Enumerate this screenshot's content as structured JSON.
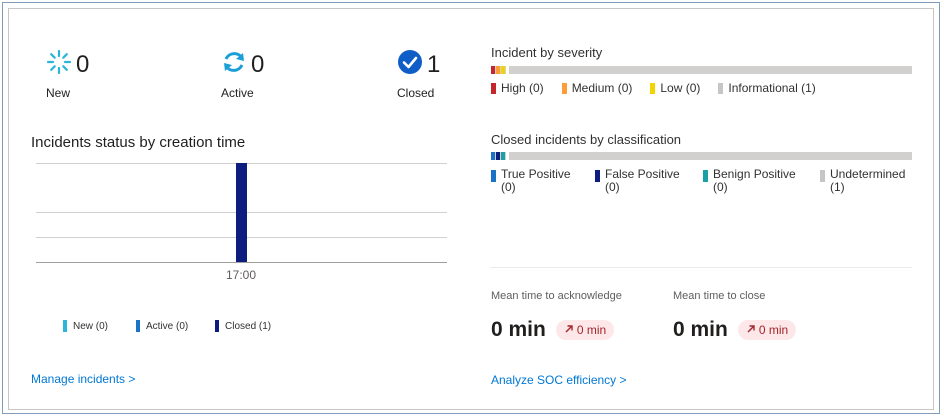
{
  "counters": {
    "new": {
      "value": "0",
      "label": "New",
      "icon": "loading-spinner-icon"
    },
    "active": {
      "value": "0",
      "label": "Active",
      "icon": "refresh-icon"
    },
    "closed": {
      "value": "1",
      "label": "Closed",
      "icon": "check-circle-icon"
    }
  },
  "status_chart": {
    "title": "Incidents status by creation time",
    "footer_link": "Manage incidents >",
    "chart_data": {
      "type": "bar",
      "categories": [
        "17:00"
      ],
      "series": [
        {
          "name": "New (0)",
          "values": [
            0
          ],
          "color": "#2bb6d9"
        },
        {
          "name": "Active (0)",
          "values": [
            0
          ],
          "color": "#1a73c7"
        },
        {
          "name": "Closed (1)",
          "values": [
            1
          ],
          "color": "#0d1d7e"
        }
      ],
      "ylim": [
        0,
        1
      ],
      "grid": true,
      "legend": "bottom"
    }
  },
  "severity": {
    "title": "Incident by severity",
    "items": [
      {
        "label": "High (0)",
        "color": "#c4262c"
      },
      {
        "label": "Medium (0)",
        "color": "#ff9c3a"
      },
      {
        "label": "Low (0)",
        "color": "#f2d400"
      },
      {
        "label": "Informational (1)",
        "color": "#c8c6c4"
      }
    ]
  },
  "classification": {
    "title": "Closed incidents by classification",
    "items": [
      {
        "label_line1": "True Positive",
        "label_line2": "(0)",
        "color": "#1a73c7"
      },
      {
        "label_line1": "False Positive",
        "label_line2": "(0)",
        "color": "#0d1d7e"
      },
      {
        "label_line1": "Benign Positive",
        "label_line2": "(0)",
        "color": "#1aa1a8"
      },
      {
        "label_line1": "Undetermined",
        "label_line2": "(1)",
        "color": "#c8c6c4"
      }
    ]
  },
  "metrics": {
    "acknowledge": {
      "label": "Mean time to acknowledge",
      "value": "0 min",
      "delta": "0 min"
    },
    "close": {
      "label": "Mean time to close",
      "value": "0 min",
      "delta": "0 min"
    },
    "footer_link": "Analyze SOC efficiency >"
  }
}
